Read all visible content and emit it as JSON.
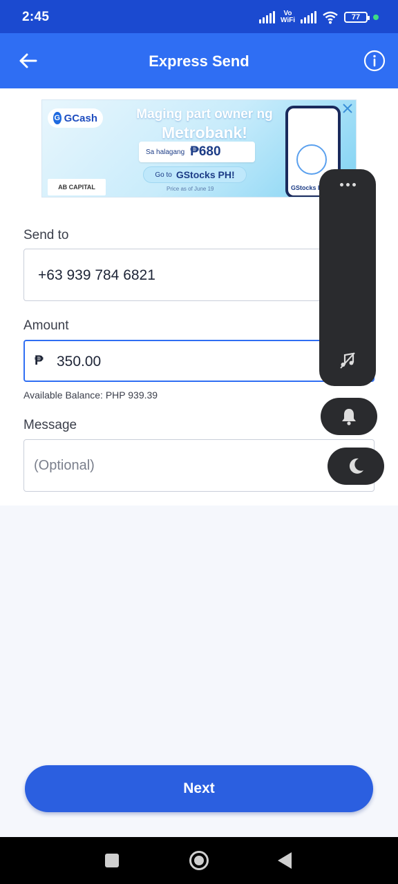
{
  "status_bar": {
    "time": "2:45",
    "vowifi_top": "Vo",
    "vowifi_bottom": "WiFi",
    "battery": "77"
  },
  "header": {
    "title": "Express Send",
    "back_icon": "arrow-left-icon",
    "info_icon": "info-icon",
    "color": "#2f6ef3"
  },
  "ad": {
    "brand": "GCash",
    "headline_line1": "Maging part owner ng",
    "headline_line2": "Metrobank!",
    "price_prefix": "Sa halagang",
    "price": "₱680",
    "cta_prefix": "Go to",
    "cta": "GStocks PH!",
    "fine_print": "Price as of June 19",
    "sponsor": "AB CAPITAL",
    "phone_label": "GStocks PH"
  },
  "form": {
    "send_to_label": "Send to",
    "send_to_value": "+63 939 784 6821",
    "amount_label": "Amount",
    "currency_symbol": "₱",
    "amount_value": "350.00",
    "balance_text": "Available Balance: PHP 939.39",
    "message_label": "Message",
    "message_placeholder": "(Optional)"
  },
  "overlay": {
    "more_icon": "more-dots-icon",
    "music_icon": "music-off-icon",
    "bell_icon": "bell-icon",
    "moon_icon": "moon-icon"
  },
  "actions": {
    "next_label": "Next",
    "accent": "#2b5fe0"
  }
}
